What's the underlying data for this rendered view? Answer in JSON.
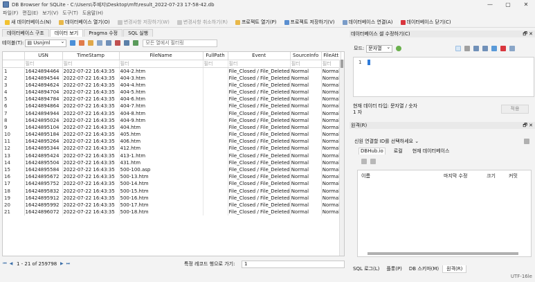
{
  "window": {
    "title": "DB Browser for SQLite - C:\\Users\\주예지\\Desktop\\mft\\result_2022-07-23 17-58-42.db",
    "min": "—",
    "max": "▢",
    "close": "✕"
  },
  "menu": [
    "파일(F)",
    "편집(E)",
    "보기(V)",
    "도구(T)",
    "도움말(H)"
  ],
  "toolbar": {
    "new_db": "새 데이터베이스(N)",
    "open_db": "데이터베이스 열기(O)",
    "write_changes": "변경사항 저장하기(W)",
    "revert_changes": "변경사항 취소하기(R)",
    "open_project": "프로젝트 열기(P)",
    "save_project": "프로젝트 저장하기(V)",
    "attach_db": "데이터베이스 연결(A)",
    "close_db": "데이터베이스 닫기(C)"
  },
  "tabs": [
    "데이터베이스 구조",
    "데이터 보기",
    "Pragma 수정",
    "SQL 실행"
  ],
  "filterbar": {
    "table_label": "테이블(T):",
    "table_value": "▤ Usnjrnl",
    "filter_all_placeholder": "모든 열에서 필터링"
  },
  "grid": {
    "columns": [
      "USN",
      "TimeStamp",
      "FileName",
      "FullPath",
      "Event",
      "SourceInfo",
      "FileAtt"
    ],
    "filter_placeholder": "필터",
    "rows": [
      [
        "1",
        "16424894464",
        "2022-07-22 16:43:35",
        "404-2.htm",
        "",
        "File_Closed / File_Deleted",
        "Normal",
        "Normal"
      ],
      [
        "2",
        "16424894544",
        "2022-07-22 16:43:35",
        "404-3.htm",
        "",
        "File_Closed / File_Deleted",
        "Normal",
        "Normal"
      ],
      [
        "3",
        "16424894624",
        "2022-07-22 16:43:35",
        "404-4.htm",
        "",
        "File_Closed / File_Deleted",
        "Normal",
        "Normal"
      ],
      [
        "4",
        "16424894704",
        "2022-07-22 16:43:35",
        "404-5.htm",
        "",
        "File_Closed / File_Deleted",
        "Normal",
        "Normal"
      ],
      [
        "5",
        "16424894784",
        "2022-07-22 16:43:35",
        "404-6.htm",
        "",
        "File_Closed / File_Deleted",
        "Normal",
        "Normal"
      ],
      [
        "6",
        "16424894864",
        "2022-07-22 16:43:35",
        "404-7.htm",
        "",
        "File_Closed / File_Deleted",
        "Normal",
        "Normal"
      ],
      [
        "7",
        "16424894944",
        "2022-07-22 16:43:35",
        "404-8.htm",
        "",
        "File_Closed / File_Deleted",
        "Normal",
        "Normal"
      ],
      [
        "8",
        "16424895024",
        "2022-07-22 16:43:35",
        "404-9.htm",
        "",
        "File_Closed / File_Deleted",
        "Normal",
        "Normal"
      ],
      [
        "9",
        "16424895104",
        "2022-07-22 16:43:35",
        "404.htm",
        "",
        "File_Closed / File_Deleted",
        "Normal",
        "Normal"
      ],
      [
        "10",
        "16424895184",
        "2022-07-22 16:43:35",
        "405.htm",
        "",
        "File_Closed / File_Deleted",
        "Normal",
        "Normal"
      ],
      [
        "11",
        "16424895264",
        "2022-07-22 16:43:35",
        "406.htm",
        "",
        "File_Closed / File_Deleted",
        "Normal",
        "Normal"
      ],
      [
        "12",
        "16424895344",
        "2022-07-22 16:43:35",
        "412.htm",
        "",
        "File_Closed / File_Deleted",
        "Normal",
        "Normal"
      ],
      [
        "13",
        "16424895424",
        "2022-07-22 16:43:35",
        "413-1.htm",
        "",
        "File_Closed / File_Deleted",
        "Normal",
        "Normal"
      ],
      [
        "14",
        "16424895504",
        "2022-07-22 16:43:35",
        "431.htm",
        "",
        "File_Closed / File_Deleted",
        "Normal",
        "Normal"
      ],
      [
        "15",
        "16424895584",
        "2022-07-22 16:43:35",
        "500-100.asp",
        "",
        "File_Closed / File_Deleted",
        "Normal",
        "Normal"
      ],
      [
        "16",
        "16424895672",
        "2022-07-22 16:43:35",
        "500-13.htm",
        "",
        "File_Closed / File_Deleted",
        "Normal",
        "Normal"
      ],
      [
        "17",
        "16424895752",
        "2022-07-22 16:43:35",
        "500-14.htm",
        "",
        "File_Closed / File_Deleted",
        "Normal",
        "Normal"
      ],
      [
        "18",
        "16424895832",
        "2022-07-22 16:43:35",
        "500-15.htm",
        "",
        "File_Closed / File_Deleted",
        "Normal",
        "Normal"
      ],
      [
        "19",
        "16424895912",
        "2022-07-22 16:43:35",
        "500-16.htm",
        "",
        "File_Closed / File_Deleted",
        "Normal",
        "Normal"
      ],
      [
        "20",
        "16424895992",
        "2022-07-22 16:43:35",
        "500-17.htm",
        "",
        "File_Closed / File_Deleted",
        "Normal",
        "Normal"
      ],
      [
        "21",
        "16424896072",
        "2022-07-22 16:43:35",
        "500-18.htm",
        "",
        "File_Closed / File_Deleted",
        "Normal",
        "Normal"
      ]
    ]
  },
  "navbar": {
    "first": "⏮",
    "prev": "◀",
    "range_text": "1 - 21 of 259798",
    "next": "▶",
    "last": "⏭",
    "goto_label": "특정 레코드 행으로 가기:",
    "goto_value": "1"
  },
  "edit_panel": {
    "title": "데이터베이스 셀 수정하기(C)",
    "mode_label": "모드:",
    "mode_value": "문자열",
    "line_number": "1",
    "type_info": "현재 데이터 타입: 문자열 / 숫자",
    "size_info": "1 자",
    "apply_button": "적용"
  },
  "remote_panel": {
    "title": "원격(R)",
    "identity_label": "신원",
    "identity_value": "연결할 ID를 선택하세요",
    "subtabs": [
      "DBHub.io",
      "로컬",
      "현재 데이터베이스"
    ],
    "columns": [
      "이름",
      "마지막 수정",
      "크기",
      "커밋"
    ]
  },
  "bottom_tabs": [
    "SQL 로그(L)",
    "플롯(P)",
    "DB 스키마(M)",
    "원격(R)"
  ],
  "status": {
    "encoding": "UTF-16le"
  },
  "colors": {
    "accent": "#2f7bd9",
    "close_red": "#d9363e",
    "nav_blue": "#3a6ea8"
  }
}
